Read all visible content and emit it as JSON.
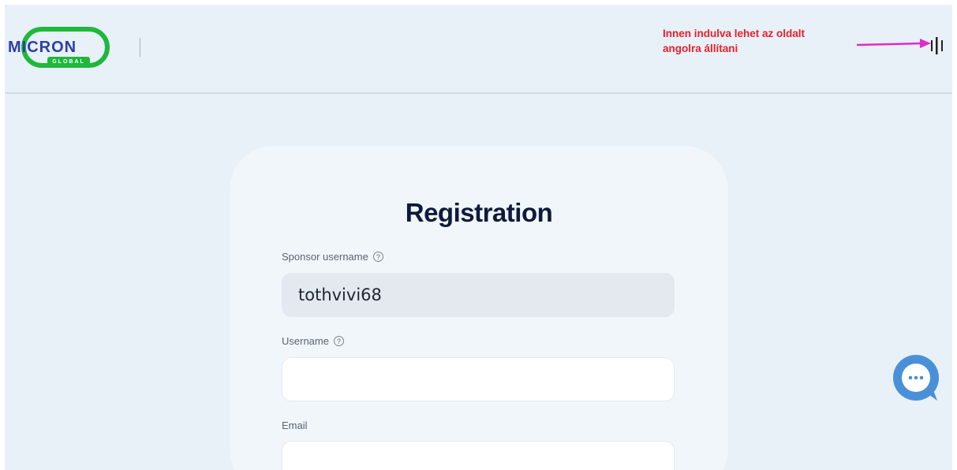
{
  "header": {
    "logo": {
      "text_top": "MICRON",
      "text_bottom": "GLOBAL",
      "colors": {
        "ring": "#1fb83c",
        "text": "#2b3fa6",
        "ring_text": "#ffffff"
      }
    },
    "annotation": {
      "line1": "Innen indulva lehet az oldalt",
      "line2": "angolra állítani",
      "color": "#e8202a",
      "arrow_color": "#e02acb"
    },
    "menu_icon": "vertical-bars-menu-icon"
  },
  "form": {
    "title": "Registration",
    "sponsor": {
      "label": "Sponsor username",
      "help_icon": "?",
      "value": "tothvivi68"
    },
    "username": {
      "label": "Username",
      "help_icon": "?",
      "value": ""
    },
    "email": {
      "label": "Email",
      "value": ""
    }
  },
  "chat": {
    "icon": "chat-bubble-icon",
    "color": "#4a90d9"
  }
}
